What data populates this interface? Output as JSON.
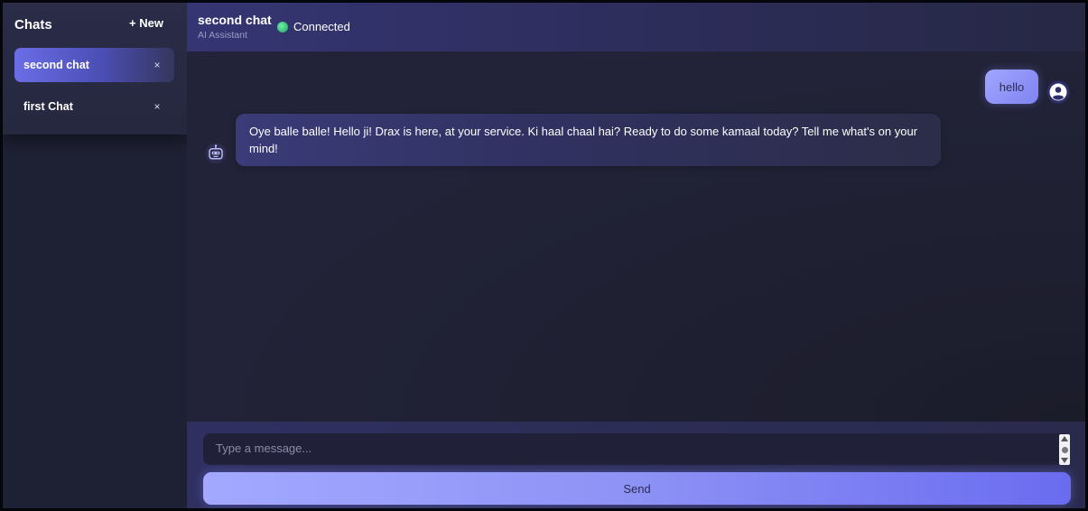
{
  "sidebar": {
    "title": "Chats",
    "new_label": "+ New",
    "items": [
      {
        "label": "second chat",
        "close": "×",
        "active": true
      },
      {
        "label": "first Chat",
        "close": "×",
        "active": false
      }
    ]
  },
  "header": {
    "title": "second chat",
    "subtitle": "AI Assistant",
    "status": "Connected"
  },
  "messages": [
    {
      "role": "user",
      "text": "hello",
      "avatar_icon": "user-circle-icon"
    },
    {
      "role": "bot",
      "text": "Oye balle balle! Hello ji! Drax is here, at your service. Ki haal chaal hai? Ready to do some kamaal today? Tell me what's on your mind!",
      "avatar_icon": "robot-icon"
    }
  ],
  "composer": {
    "placeholder": "Type a message...",
    "value": "",
    "send_label": "Send"
  },
  "colors": {
    "accent": "#7f83f0",
    "status_connected": "#2fb06c",
    "background": "#222338"
  }
}
